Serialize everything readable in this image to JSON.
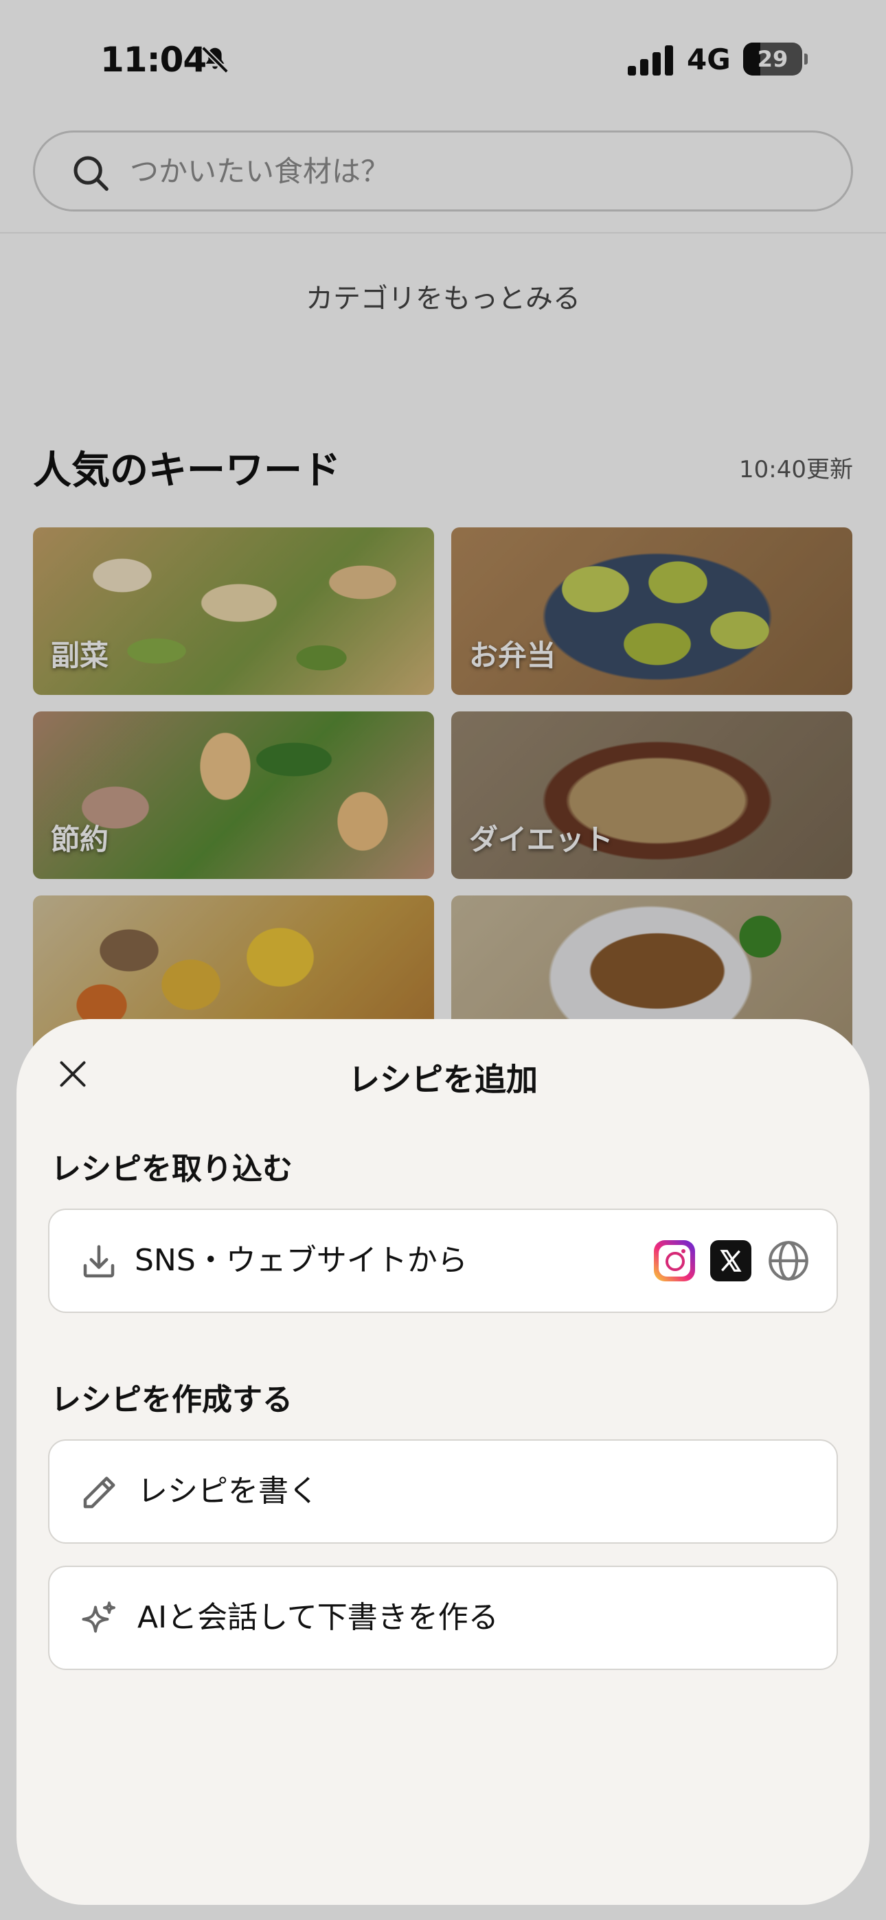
{
  "status_bar": {
    "time": "11:04",
    "network": "4G",
    "battery_level": "29",
    "battery_fraction": 0.29
  },
  "search": {
    "placeholder": "つかいたい食材は？"
  },
  "categories": {
    "more_label": "カテゴリをもっとみる"
  },
  "keywords": {
    "title": "人気のキーワード",
    "updated": "10:40更新",
    "tiles": [
      {
        "label": "副菜"
      },
      {
        "label": "お弁当"
      },
      {
        "label": "節約"
      },
      {
        "label": "ダイエット"
      },
      {
        "label": ""
      },
      {
        "label": ""
      }
    ]
  },
  "sheet": {
    "title": "レシピを追加",
    "import_section": {
      "title": "レシピを取り込む",
      "option_label": "SNS・ウェブサイトから",
      "icons": [
        "instagram-icon",
        "x-icon",
        "globe-icon"
      ]
    },
    "create_section": {
      "title": "レシピを作成する",
      "write_label": "レシピを書く",
      "ai_label": "AIと会話して下書きを作る"
    }
  },
  "colors": {
    "sheet_background": "#f5f3f0",
    "overlay": "rgba(0,0,0,0.2)",
    "option_border": "#d6d4d0"
  }
}
